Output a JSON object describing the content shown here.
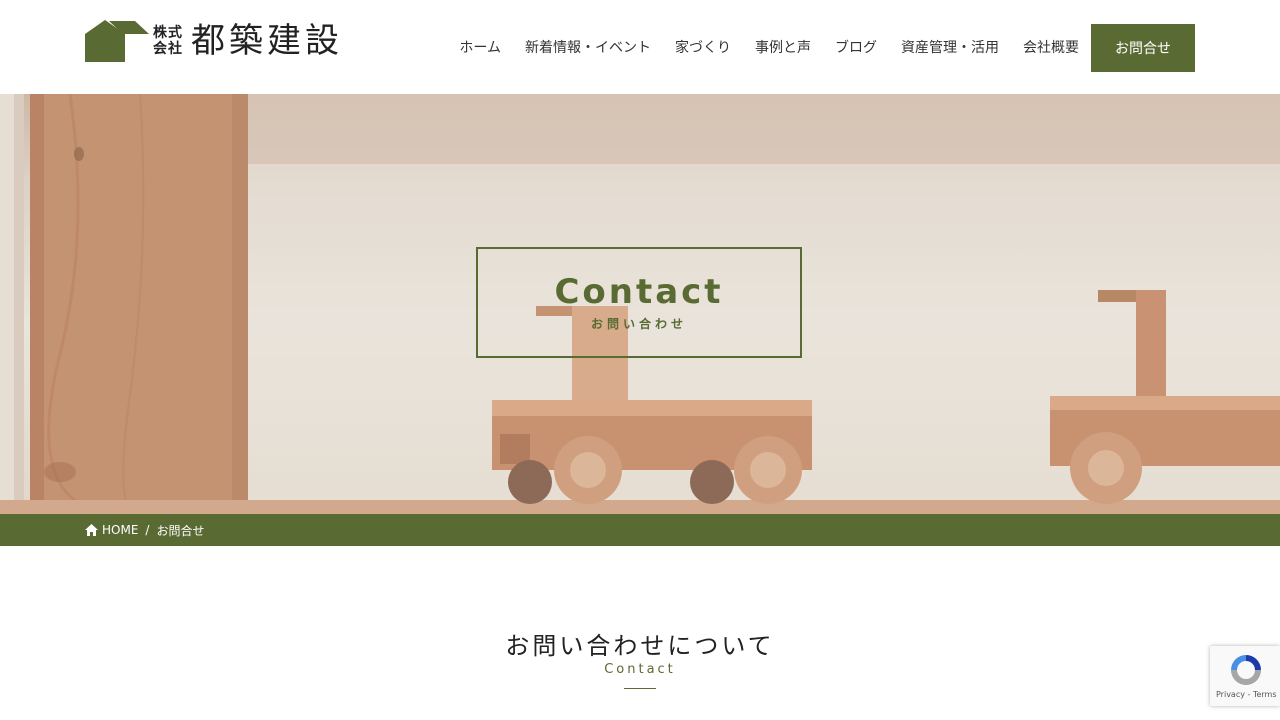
{
  "header": {
    "logo_small_top": "株式",
    "logo_small_bottom": "会社",
    "logo_main": "都築建設",
    "nav": [
      {
        "label": "ホーム"
      },
      {
        "label": "新着情報・イベント"
      },
      {
        "label": "家づくり"
      },
      {
        "label": "事例と声"
      },
      {
        "label": "ブログ"
      },
      {
        "label": "資産管理・活用"
      },
      {
        "label": "会社概要"
      }
    ],
    "cta_label": "お問合せ"
  },
  "hero": {
    "title": "Contact",
    "subtitle": "お問い合わせ"
  },
  "breadcrumb": {
    "home_label": "HOME",
    "separator": "/",
    "current": "お問合せ"
  },
  "section": {
    "title": "お問い合わせについて",
    "subtitle": "Contact"
  },
  "recaptcha": {
    "links": "Privacy - Terms"
  },
  "colors": {
    "brand_green": "#5a6a33",
    "white": "#ffffff"
  },
  "icons": [
    "house-logo-icon",
    "home-icon",
    "recaptcha-icon"
  ]
}
